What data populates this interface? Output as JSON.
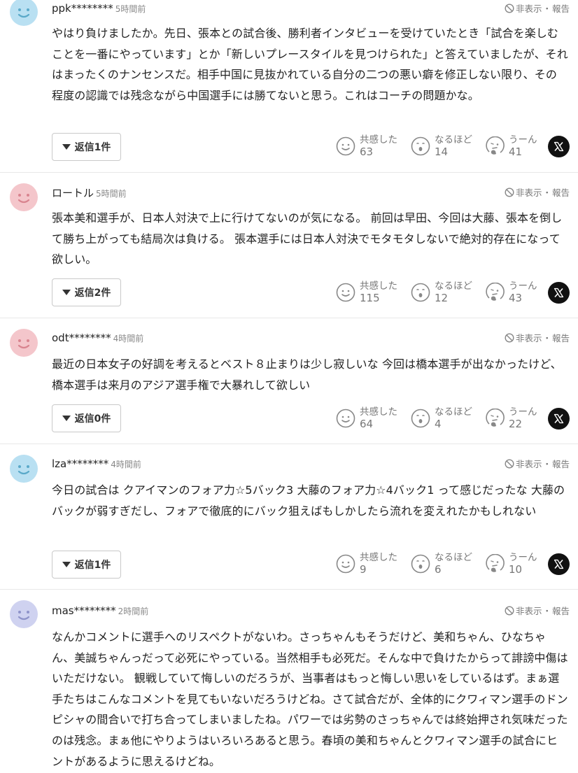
{
  "ui": {
    "hide_label": "非表示",
    "separator": "・",
    "report_label": "報告"
  },
  "reactions_labels": {
    "empathy": "共感した",
    "insight": "なるほど",
    "hmm": "うーん"
  },
  "colors": {
    "avatar_blue": "#b9e0f2",
    "avatar_pink": "#f4c6cb",
    "avatar_lavender": "#cfd2f0",
    "face_blue": "#5aa9c9",
    "face_pink": "#d9848f",
    "face_lavender": "#8e93c9"
  },
  "comments": [
    {
      "user": "ppk********",
      "time": "5時間前",
      "avatar_color": "blue",
      "text": "やはり負けましたか。先日、張本との試合後、勝利者インタビューを受けていたとき「試合を楽しむことを一番にやっています」とか「新しいプレースタイルを見つけられた」と答えていましたが、それはまったくのナンセンスだ。相手中国に見抜かれている自分の二つの悪い癖を修正しない限り、その程度の認識では残念ながら中国選手には勝てないと思う。これはコーチの問題かな。",
      "reply_label": "返信1件",
      "counts": {
        "empathy": "63",
        "insight": "14",
        "hmm": "41"
      }
    },
    {
      "user": "ロートル",
      "time": "5時間前",
      "avatar_color": "pink",
      "text": "張本美和選手が、日本人対決で上に行けてないのが気になる。 前回は早田、今回は大藤、張本を倒して勝ち上がっても結局次は負ける。 張本選手には日本人対決でモタモタしないで絶対的存在になって欲しい。",
      "reply_label": "返信2件",
      "counts": {
        "empathy": "115",
        "insight": "12",
        "hmm": "43"
      }
    },
    {
      "user": "odt********",
      "time": "4時間前",
      "avatar_color": "pink",
      "text": "最近の日本女子の好調を考えるとベスト８止まりは少し寂しいな 今回は橋本選手が出なかったけど、橋本選手は来月のアジア選手権で大暴れして欲しい",
      "reply_label": "返信0件",
      "counts": {
        "empathy": "64",
        "insight": "4",
        "hmm": "22"
      }
    },
    {
      "user": "lza********",
      "time": "4時間前",
      "avatar_color": "blue",
      "text": "今日の試合は クアイマンのフォア力☆5バック3 大藤のフォア力☆4バック1 って感じだったな 大藤のバックが弱すぎだし、フォアで徹底的にバック狙えばもしかしたら流れを変えれたかもしれない",
      "reply_label": "返信1件",
      "counts": {
        "empathy": "9",
        "insight": "6",
        "hmm": "10"
      }
    },
    {
      "user": "mas********",
      "time": "2時間前",
      "avatar_color": "lavender",
      "text": "なんかコメントに選手へのリスペクトがないわ。さっちゃんもそうだけど、美和ちゃん、ひなちゃん、美誠ちゃんっだって必死にやっている。当然相手も必死だ。そんな中で負けたからって誹謗中傷はいただけない。 観戦していて悔しいのだろうが、当事者はもっと悔しい思いをしているはず。まぁ選手たちはこんなコメントを見てもいないだろうけどね。さて試合だが、全体的にクワィマン選手のドンピシャの間合いで打ち合ってしまいましたね。パワーでは劣勢のさっちゃんでは終始押され気味だったのは残念。まぁ他にやりようはいろいろあると思う。春頃の美和ちゃんとクワィマン選手の試合にヒントがあるように思えるけどね。"
    }
  ]
}
